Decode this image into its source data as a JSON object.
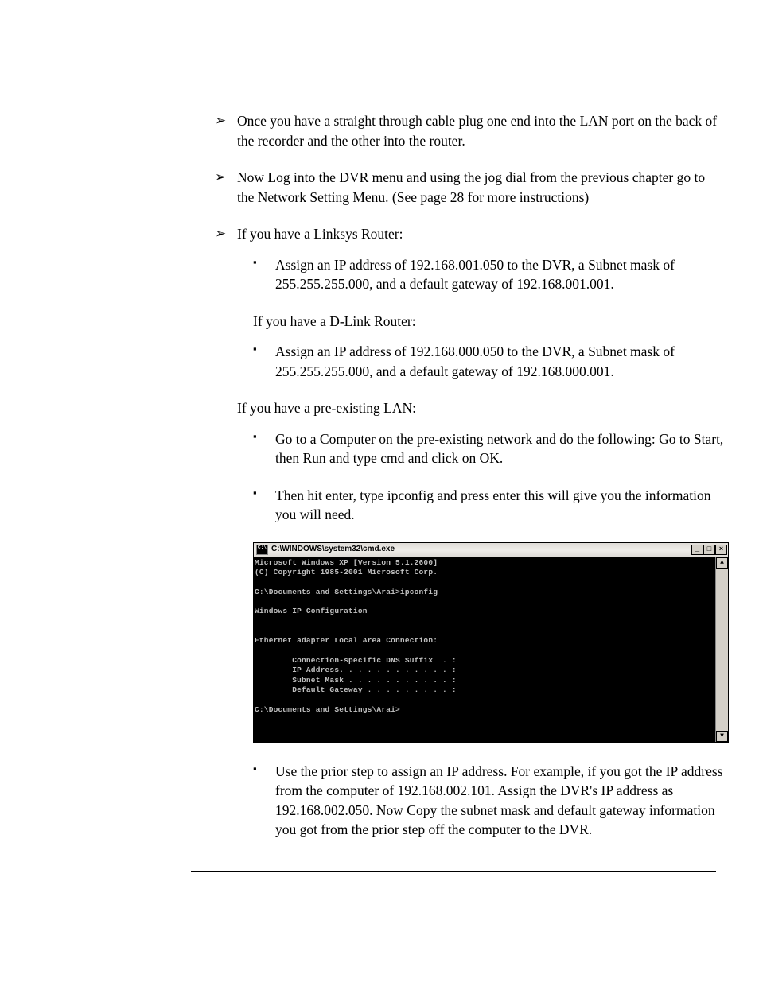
{
  "bullets": {
    "b1": "Once you have a straight through cable plug one end into the LAN port on the back of the recorder and the other into the router.",
    "b2": "Now Log into the  DVR menu and using the jog dial from the previous chapter go to the Network Setting Menu. (See page 28 for more instructions)",
    "b3": "If you have a Linksys Router:",
    "sub_linksys": "Assign an IP address of 192.168.001.050 to the DVR, a Subnet mask of 255.255.255.000, and a default gateway of 192.168.001.001.",
    "dlink_label": "If you have a D-Link Router:",
    "sub_dlink": "Assign an IP address of 192.168.000.050 to the DVR, a Subnet mask of 255.255.255.000, and a default gateway of 192.168.000.001.",
    "lan_label": "If you have a pre-existing LAN:",
    "sub_lan1": "Go to a Computer on the pre-existing network and do the following: Go to Start, then Run and type cmd and click on OK.",
    "sub_lan2": "Then hit enter, type ipconfig and press enter this will give you the information you will need.",
    "sub_lan3": "Use the prior step to assign an IP address. For example, if you got the IP address from the computer of 192.168.002.101. Assign the DVR's IP address as 192.168.002.050. Now Copy the subnet mask and default gateway information you got from the prior step off the computer to the DVR."
  },
  "cmd": {
    "title": "C:\\WINDOWS\\system32\\cmd.exe",
    "controls": {
      "min": "_",
      "max": "□",
      "close": "×"
    },
    "scroll": {
      "up": "▲",
      "down": "▼"
    },
    "body": "Microsoft Windows XP [Version 5.1.2600]\n(C) Copyright 1985-2001 Microsoft Corp.\n\nC:\\Documents and Settings\\Arai>ipconfig\n\nWindows IP Configuration\n\n\nEthernet adapter Local Area Connection:\n\n        Connection-specific DNS Suffix  . :\n        IP Address. . . . . . . . . . . . :\n        Subnet Mask . . . . . . . . . . . :\n        Default Gateway . . . . . . . . . :\n\nC:\\Documents and Settings\\Arai>_"
  }
}
